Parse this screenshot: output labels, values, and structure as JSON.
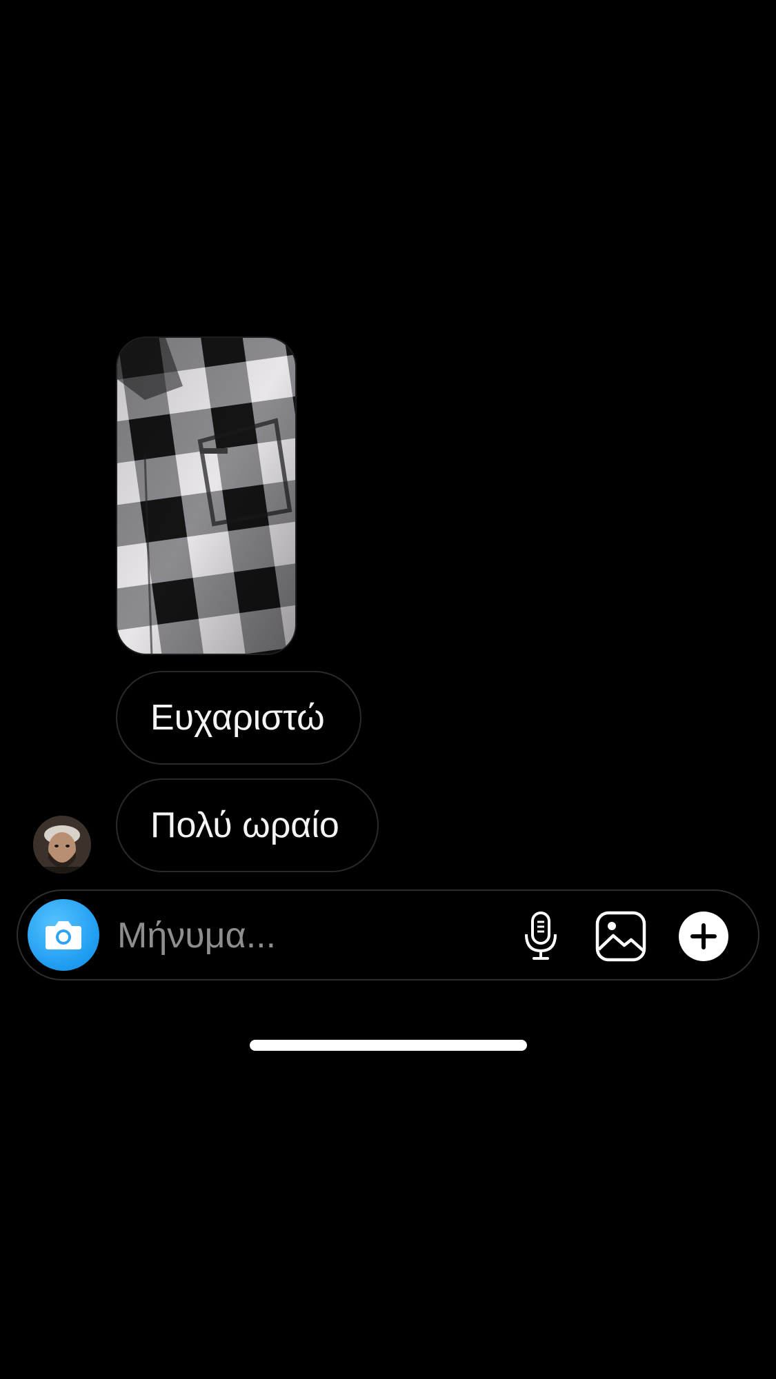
{
  "thread": {
    "photo_message": {
      "alt": "plaid-shirt-photo"
    },
    "messages": [
      {
        "text": "Ευχαριστώ"
      },
      {
        "text": "Πολύ ωραίο"
      }
    ],
    "sender_avatar": {
      "icon": "profile-avatar"
    }
  },
  "composer": {
    "placeholder": "Μήνυμα...",
    "value": "",
    "camera_icon": "camera-icon",
    "mic_icon": "microphone-icon",
    "gallery_icon": "image-gallery-icon",
    "plus_icon": "plus-circle-icon",
    "accent_color": "#1d9bf0"
  }
}
